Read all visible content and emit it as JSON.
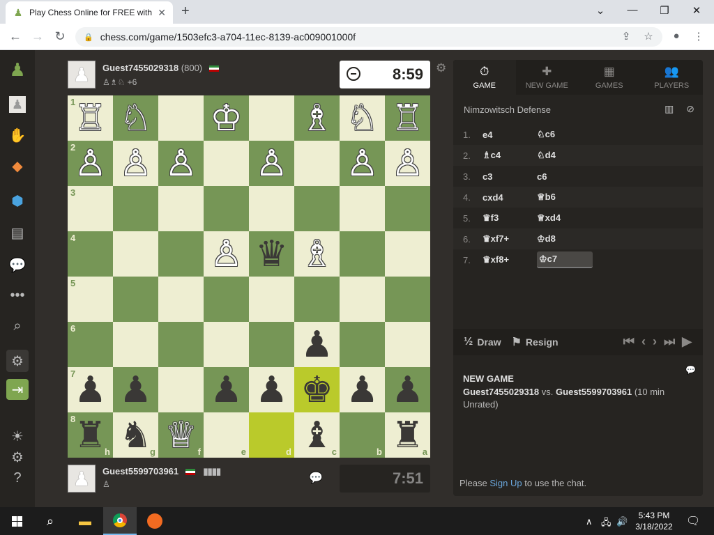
{
  "browser": {
    "tab_title": "Play Chess Online for FREE with Friends",
    "url": "chess.com/game/1503efc3-a704-11ec-8139-ac009001000f"
  },
  "top_player": {
    "name": "Guest7455029318",
    "rating": "(800)",
    "captured": "♙♗♘",
    "advantage": "+6",
    "clock": "8:59"
  },
  "bottom_player": {
    "name": "Guest5599703961",
    "captured": "♙",
    "clock": "7:51"
  },
  "board": {
    "ranks": [
      "1",
      "2",
      "3",
      "4",
      "5",
      "6",
      "7",
      "8"
    ],
    "files": [
      "h",
      "g",
      "f",
      "e",
      "d",
      "c",
      "b",
      "a"
    ],
    "squares": [
      [
        "wR",
        "wN",
        "",
        "wK",
        "",
        "wB",
        "wN",
        "wR"
      ],
      [
        "wP",
        "wP",
        "wP",
        "",
        "wP",
        "",
        "wP",
        "wP"
      ],
      [
        "",
        "",
        "",
        "",
        "",
        "",
        "",
        ""
      ],
      [
        "",
        "",
        "",
        "wP",
        "bQ",
        "wB",
        "",
        ""
      ],
      [
        "",
        "",
        "",
        "",
        "",
        "",
        "",
        ""
      ],
      [
        "",
        "",
        "",
        "",
        "",
        "bP",
        "",
        ""
      ],
      [
        "bP",
        "bP",
        "",
        "bP",
        "bP",
        "bK",
        "bP",
        "bP"
      ],
      [
        "bR",
        "bN",
        "wQ",
        "",
        "",
        "bB",
        "",
        "bR"
      ]
    ],
    "highlighted": [
      [
        6,
        5
      ],
      [
        7,
        4
      ]
    ]
  },
  "panel": {
    "tabs": [
      {
        "label": "GAME",
        "icon": "⏱"
      },
      {
        "label": "NEW GAME",
        "icon": "✚"
      },
      {
        "label": "GAMES",
        "icon": "▦"
      },
      {
        "label": "PLAYERS",
        "icon": "👥"
      }
    ],
    "opening": "Nimzowitsch Defense",
    "moves": [
      {
        "num": "1.",
        "white": "e4",
        "black": "♘c6"
      },
      {
        "num": "2.",
        "white": "♗c4",
        "black": "♘d4"
      },
      {
        "num": "3.",
        "white": "c3",
        "black": "c6"
      },
      {
        "num": "4.",
        "white": "cxd4",
        "black": "♕b6"
      },
      {
        "num": "5.",
        "white": "♛f3",
        "black": "♕xd4"
      },
      {
        "num": "6.",
        "white": "♛xf7+",
        "black": "♔d8"
      },
      {
        "num": "7.",
        "white": "♛xf8+",
        "black": "♔c7"
      }
    ],
    "draw_label": "Draw",
    "draw_icon": "½",
    "resign_label": "Resign",
    "new_game_title": "NEW GAME",
    "new_game_white": "Guest7455029318",
    "new_game_vs": "vs.",
    "new_game_black": "Guest5599703961",
    "new_game_detail": "(10 min Unrated)",
    "chat_prefix": "Please",
    "chat_link": "Sign Up",
    "chat_suffix": "to use the chat."
  },
  "taskbar": {
    "time": "5:43 PM",
    "date": "3/18/2022"
  }
}
